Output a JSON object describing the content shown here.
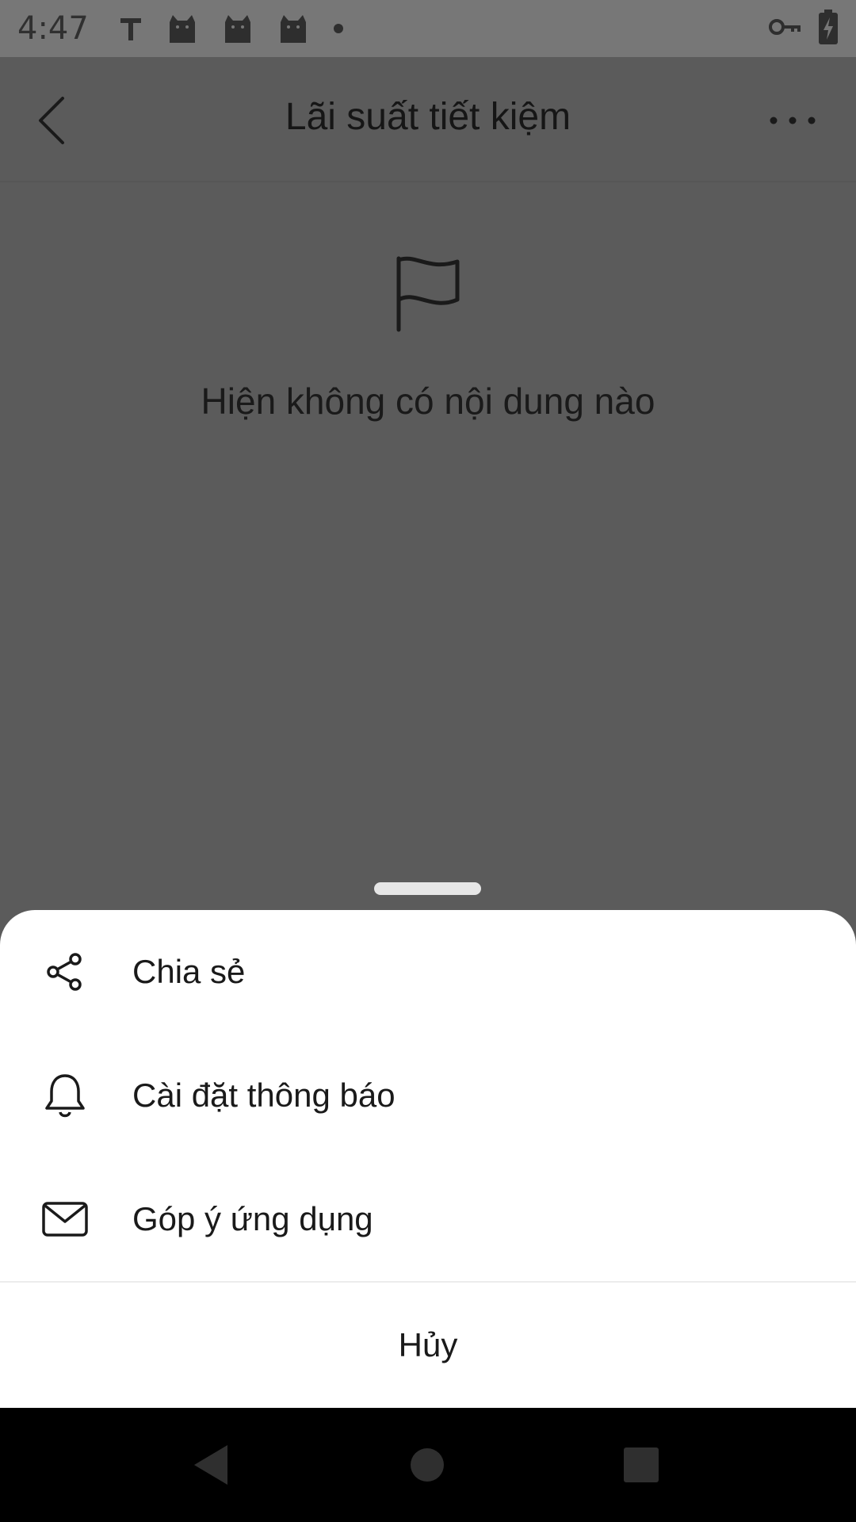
{
  "status_bar": {
    "time": "4:47",
    "notification_icons": [
      "t-icon",
      "cat-icon",
      "cat-icon",
      "cat-icon",
      "dot-icon"
    ],
    "right_icons": [
      "vpn-key-icon",
      "battery-charging-icon"
    ]
  },
  "header": {
    "title": "Lãi suất tiết kiệm",
    "back_icon": "chevron-left-icon",
    "more_icon": "more-horizontal-icon"
  },
  "empty_state": {
    "icon": "flag-icon",
    "message": "Hiện không có nội dung nào"
  },
  "sheet": {
    "items": [
      {
        "label": "Chia sẻ",
        "icon": "share-icon"
      },
      {
        "label": "Cài đặt thông báo",
        "icon": "bell-icon"
      },
      {
        "label": "Góp ý ứng dụng",
        "icon": "mail-icon"
      }
    ],
    "cancel_label": "Hủy"
  },
  "colors": {
    "scrim": "#5b5b5b",
    "status_bar": "#777777",
    "sheet_bg": "#ffffff",
    "nav_bar": "#000000",
    "text": "#1a1a1a"
  }
}
